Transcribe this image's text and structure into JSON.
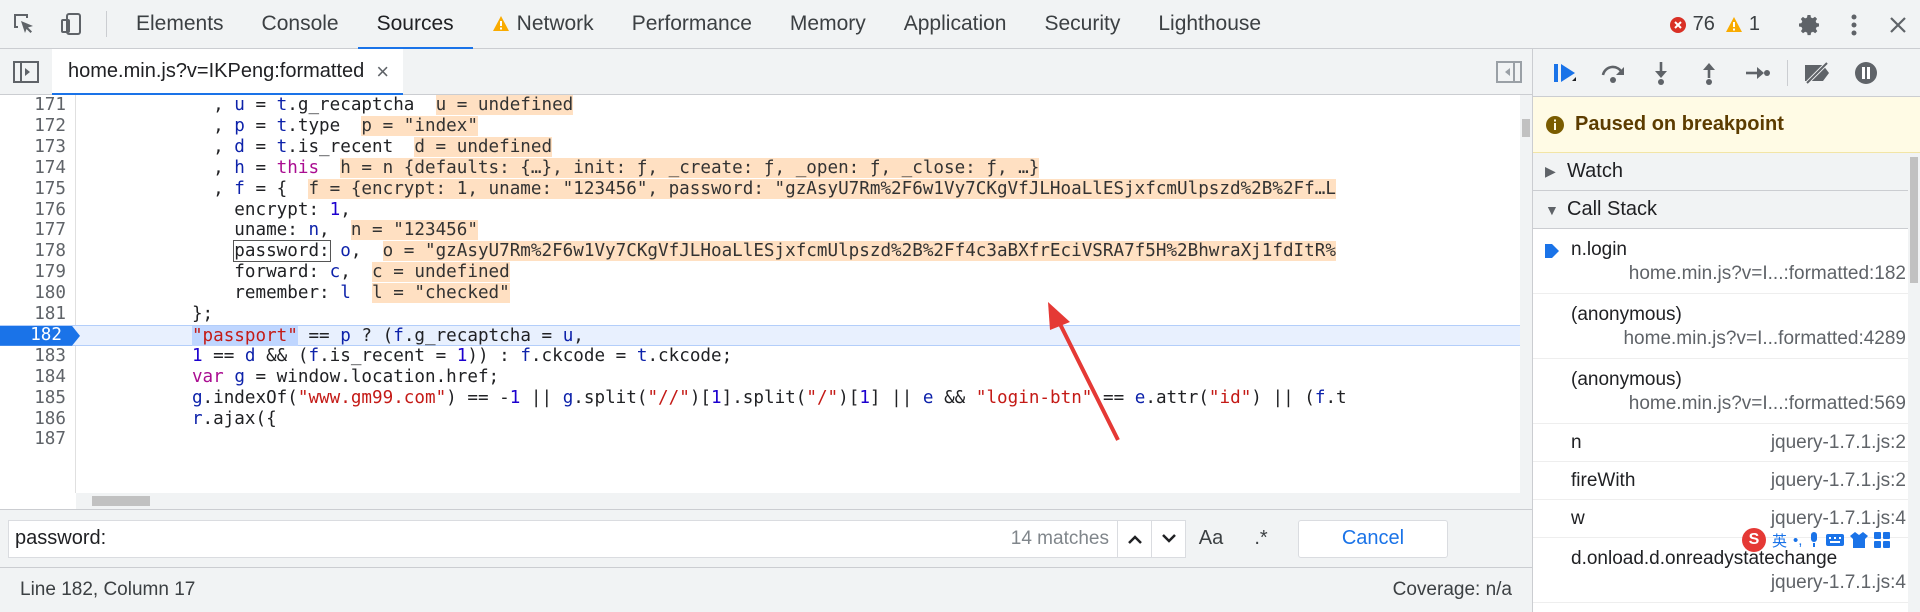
{
  "tabs": [
    {
      "label": "Elements"
    },
    {
      "label": "Console"
    },
    {
      "label": "Sources",
      "active": true
    },
    {
      "label": "Network",
      "warning": true
    },
    {
      "label": "Performance"
    },
    {
      "label": "Memory"
    },
    {
      "label": "Application"
    },
    {
      "label": "Security"
    },
    {
      "label": "Lighthouse"
    }
  ],
  "counts": {
    "errors": "76",
    "warnings": "1"
  },
  "file_tab": {
    "name": "home.min.js?v=IKPeng:formatted",
    "close": "×"
  },
  "code": {
    "line_numbers": [
      "171",
      "172",
      "173",
      "174",
      "175",
      "176",
      "177",
      "178",
      "179",
      "180",
      "181",
      "182",
      "183",
      "184",
      "185",
      "186",
      "187"
    ],
    "lines": [
      {
        "indent": "            ",
        "parts": [
          {
            "t": ", "
          },
          {
            "t": "u",
            "c": "var"
          },
          {
            "t": " = "
          },
          {
            "t": "t",
            "c": "var"
          },
          {
            "t": ".g_recaptcha  "
          },
          {
            "t": "u = undefined",
            "c": "inl"
          }
        ]
      },
      {
        "indent": "            ",
        "parts": [
          {
            "t": ", "
          },
          {
            "t": "p",
            "c": "var"
          },
          {
            "t": " = "
          },
          {
            "t": "t",
            "c": "var"
          },
          {
            "t": ".type  "
          },
          {
            "t": "p = \"index\"",
            "c": "inl"
          }
        ]
      },
      {
        "indent": "            ",
        "parts": [
          {
            "t": ", "
          },
          {
            "t": "d",
            "c": "var"
          },
          {
            "t": " = "
          },
          {
            "t": "t",
            "c": "var"
          },
          {
            "t": ".is_recent  "
          },
          {
            "t": "d = undefined",
            "c": "inl"
          }
        ]
      },
      {
        "indent": "            ",
        "parts": [
          {
            "t": ", "
          },
          {
            "t": "h",
            "c": "var"
          },
          {
            "t": " = "
          },
          {
            "t": "this",
            "c": "kw"
          },
          {
            "t": "  "
          },
          {
            "t": "h = n {defaults: {…}, init: ƒ, _create: ƒ, _open: ƒ, _close: ƒ, …}",
            "c": "inl"
          }
        ]
      },
      {
        "indent": "            ",
        "parts": [
          {
            "t": ", "
          },
          {
            "t": "f",
            "c": "var"
          },
          {
            "t": " = {  "
          },
          {
            "t": "f = {encrypt: 1, uname: \"123456\", password: \"gzAsyU7Rm%2F6w1Vy7CKgVfJLHoaLlESjxfcmUlpszd%2B%2Ff…L",
            "c": "inl"
          }
        ]
      },
      {
        "indent": "              ",
        "parts": [
          {
            "t": "encrypt: "
          },
          {
            "t": "1",
            "c": "num"
          },
          {
            "t": ","
          }
        ]
      },
      {
        "indent": "              ",
        "parts": [
          {
            "t": "uname: "
          },
          {
            "t": "n",
            "c": "var"
          },
          {
            "t": ",  "
          },
          {
            "t": "n = \"123456\"",
            "c": "inl"
          }
        ]
      },
      {
        "indent": "              ",
        "parts": [
          {
            "t": "password:",
            "c": "mark"
          },
          {
            "t": " "
          },
          {
            "t": "o",
            "c": "var"
          },
          {
            "t": ",  "
          },
          {
            "t": "o = \"gzAsyU7Rm%2F6w1Vy7CKgVfJLHoaLlESjxfcmUlpszd%2B%2Ff4c3aBXfrEciVSRA7f5H%2BhwraXj1fdItR%",
            "c": "inl"
          }
        ]
      },
      {
        "indent": "              ",
        "parts": [
          {
            "t": "forward: "
          },
          {
            "t": "c",
            "c": "var"
          },
          {
            "t": ",  "
          },
          {
            "t": "c = undefined",
            "c": "inl"
          }
        ]
      },
      {
        "indent": "              ",
        "parts": [
          {
            "t": "remember: "
          },
          {
            "t": "l",
            "c": "var"
          },
          {
            "t": "  "
          },
          {
            "t": "l = \"checked\"",
            "c": "inl"
          }
        ]
      },
      {
        "indent": "          ",
        "parts": [
          {
            "t": "};"
          }
        ]
      },
      {
        "indent": "          ",
        "parts": [
          {
            "t": "\"passport\"",
            "c": "str sel"
          },
          {
            "t": " == "
          },
          {
            "t": "p",
            "c": "var"
          },
          {
            "t": " ? ("
          },
          {
            "t": "f",
            "c": "var"
          },
          {
            "t": ".g_recaptcha = "
          },
          {
            "t": "u",
            "c": "var"
          },
          {
            "t": ","
          }
        ]
      },
      {
        "indent": "          ",
        "parts": [
          {
            "t": "1",
            "c": "num"
          },
          {
            "t": " == "
          },
          {
            "t": "d",
            "c": "var"
          },
          {
            "t": " && ("
          },
          {
            "t": "f",
            "c": "var"
          },
          {
            "t": ".is_recent = "
          },
          {
            "t": "1",
            "c": "num"
          },
          {
            "t": ")) : "
          },
          {
            "t": "f",
            "c": "var"
          },
          {
            "t": ".ckcode = "
          },
          {
            "t": "t",
            "c": "var"
          },
          {
            "t": ".ckcode;"
          }
        ]
      },
      {
        "indent": "          ",
        "parts": [
          {
            "t": "var",
            "c": "kw"
          },
          {
            "t": " "
          },
          {
            "t": "g",
            "c": "var"
          },
          {
            "t": " = window.location.href;"
          }
        ]
      },
      {
        "indent": "          ",
        "parts": [
          {
            "t": "g",
            "c": "var"
          },
          {
            "t": ".indexOf("
          },
          {
            "t": "\"www.gm99.com\"",
            "c": "str"
          },
          {
            "t": ") == -"
          },
          {
            "t": "1",
            "c": "num"
          },
          {
            "t": " || "
          },
          {
            "t": "g",
            "c": "var"
          },
          {
            "t": ".split("
          },
          {
            "t": "\"//\"",
            "c": "str"
          },
          {
            "t": ")["
          },
          {
            "t": "1",
            "c": "num"
          },
          {
            "t": "].split("
          },
          {
            "t": "\"/\"",
            "c": "str"
          },
          {
            "t": ")["
          },
          {
            "t": "1",
            "c": "num"
          },
          {
            "t": "] || "
          },
          {
            "t": "e",
            "c": "var"
          },
          {
            "t": " && "
          },
          {
            "t": "\"login-btn\"",
            "c": "str"
          },
          {
            "t": " == "
          },
          {
            "t": "e",
            "c": "var"
          },
          {
            "t": ".attr("
          },
          {
            "t": "\"id\"",
            "c": "str"
          },
          {
            "t": ") || ("
          },
          {
            "t": "f",
            "c": "var"
          },
          {
            "t": ".t"
          }
        ]
      },
      {
        "indent": "          ",
        "parts": [
          {
            "t": "r",
            "c": "var"
          },
          {
            "t": ".ajax({"
          }
        ]
      },
      {
        "indent": "          ",
        "parts": [
          {
            "t": ""
          }
        ]
      }
    ],
    "breakpoint_line": "182"
  },
  "search": {
    "value": "password:",
    "matches": "14 matches",
    "case_label": "Aa",
    "regex_label": ".*",
    "cancel_label": "Cancel"
  },
  "status": {
    "position": "Line 182, Column 17",
    "coverage": "Coverage: n/a"
  },
  "debugger": {
    "paused": "Paused on breakpoint",
    "watch": "Watch",
    "call_stack": "Call Stack",
    "frames": [
      {
        "fn": "n.login",
        "loc": "home.min.js?v=I...:formatted:182",
        "current": true
      },
      {
        "fn": "(anonymous)",
        "loc": "home.min.js?v=I...formatted:4289"
      },
      {
        "fn": "(anonymous)",
        "loc": "home.min.js?v=I...:formatted:569"
      }
    ],
    "short_frames": [
      {
        "fn": "n",
        "loc": "jquery-1.7.1.js:2"
      },
      {
        "fn": "fireWith",
        "loc": "jquery-1.7.1.js:2"
      },
      {
        "fn": "w",
        "loc": "jquery-1.7.1.js:4"
      }
    ],
    "last_frame": {
      "fn": "d.onload.d.onreadystatechange",
      "loc": "jquery-1.7.1.js:4"
    }
  },
  "ime": {
    "logo": "S",
    "lang": "英"
  },
  "colors": {
    "accent": "#1a73e8",
    "error": "#d93025",
    "warning": "#f9ab00",
    "annotation": "#e53935"
  }
}
